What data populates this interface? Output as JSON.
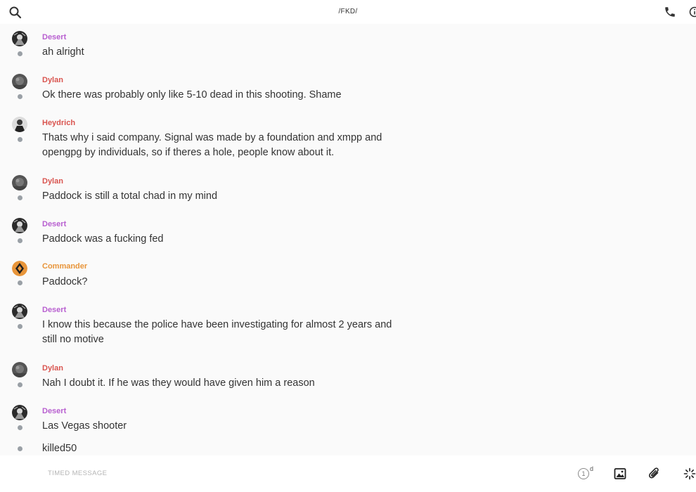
{
  "header": {
    "title": "/FKD/",
    "search_icon": "search-icon",
    "call_icon": "phone-icon",
    "info_icon": "info-icon"
  },
  "colors": {
    "desert": "#b85fd0",
    "dylan": "#d9544f",
    "heydrich": "#d9544f",
    "commander": "#e8953a",
    "text": "#333333",
    "background": "#fafafa"
  },
  "messages": [
    {
      "author": "Desert",
      "text": "ah alright"
    },
    {
      "author": "Dylan",
      "text": "Ok there was probably only like 5-10 dead in this shooting. Shame"
    },
    {
      "author": "Heydrich",
      "text": "Thats why i said company. Signal was made by a foundation and xmpp and opengpg by individuals, so if theres a hole, people know about it."
    },
    {
      "author": "Dylan",
      "text": "Paddock is still a total chad in my mind"
    },
    {
      "author": "Desert",
      "text": "Paddock was a fucking fed"
    },
    {
      "author": "Commander",
      "text": "Paddock?"
    },
    {
      "author": "Desert",
      "text": "I know this because the police have been investigating for almost 2 years and still no motive"
    },
    {
      "author": "Dylan",
      "text": "Nah I doubt it. If he was they would have given him a reason"
    },
    {
      "author": "Desert",
      "text": "Las Vegas shooter"
    },
    {
      "author": "",
      "text": "killed50"
    }
  ],
  "composer": {
    "placeholder": "TIMED MESSAGE",
    "timer_value": "1",
    "timer_unit": "d",
    "image_icon": "image-icon",
    "attach_icon": "paperclip-icon",
    "sticker_icon": "sparkle-icon"
  }
}
